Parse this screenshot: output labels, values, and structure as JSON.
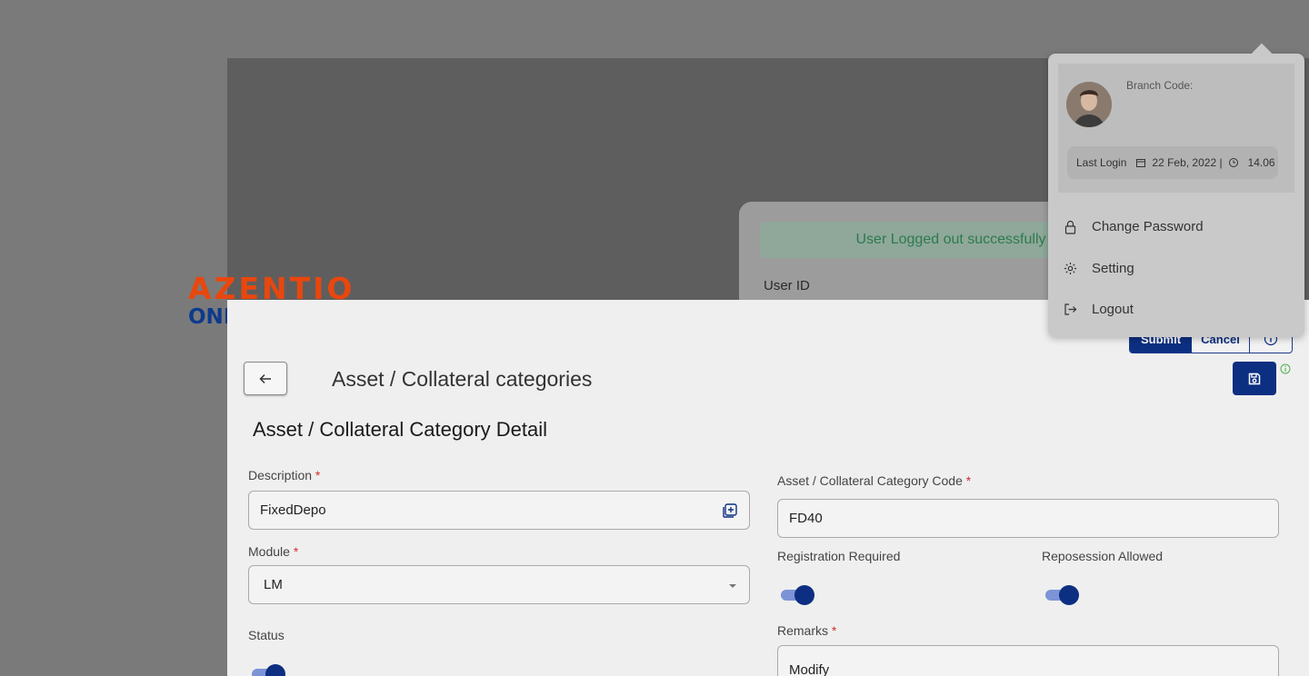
{
  "brand": {
    "name": "AZENTIO",
    "sub": "ONE"
  },
  "login": {
    "alert": "User Logged out successfully",
    "user_id_label": "User ID"
  },
  "toolbar": {
    "submit": "Submit",
    "cancel": "Cancel"
  },
  "page": {
    "title": "Asset / Collateral categories",
    "section_title": "Asset / Collateral Category Detail"
  },
  "form": {
    "description": {
      "label": "Description",
      "value": "FixedDepo"
    },
    "code": {
      "label": "Asset / Collateral Category Code",
      "value": "FD40"
    },
    "module": {
      "label": "Module",
      "value": "LM"
    },
    "registration_required": {
      "label": "Registration Required",
      "on": true
    },
    "reposession_allowed": {
      "label": "Reposession Allowed",
      "on": true
    },
    "status": {
      "label": "Status",
      "on": true
    },
    "remarks": {
      "label": "Remarks",
      "value": "Modify"
    },
    "required_mark": "*"
  },
  "user_menu": {
    "branch_code_label": "Branch Code:",
    "last_login_label": "Last Login",
    "last_login_date": "22 Feb, 2022 |",
    "last_login_time": "14.06",
    "items": [
      {
        "label": "Change Password",
        "icon": "lock-icon"
      },
      {
        "label": "Setting",
        "icon": "gear-icon"
      },
      {
        "label": "Logout",
        "icon": "logout-icon"
      }
    ]
  },
  "colors": {
    "primary": "#0d2f82",
    "brand_orange": "#e8470e",
    "success": "#2d7a4e",
    "required": "#d32f2f"
  }
}
